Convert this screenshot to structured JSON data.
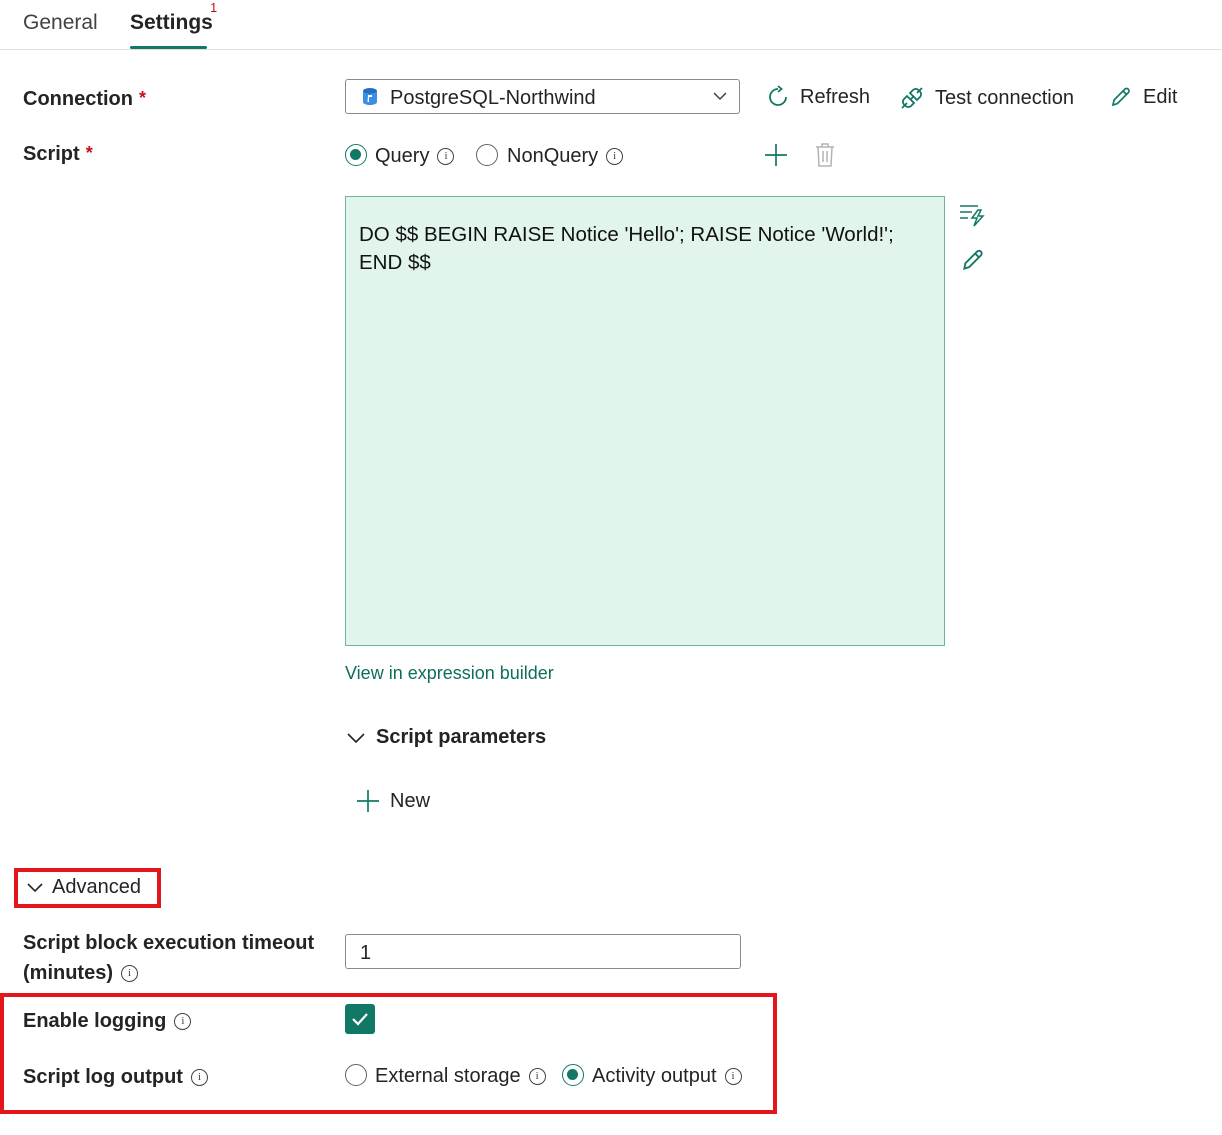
{
  "tabs": [
    {
      "label": "General",
      "active": false
    },
    {
      "label": "Settings",
      "active": true,
      "badge": "1"
    }
  ],
  "connection": {
    "label": "Connection",
    "required_marker": "*",
    "selected": "PostgreSQL-Northwind",
    "icon": "postgresql-database-icon",
    "actions": {
      "refresh": "Refresh",
      "test": "Test connection",
      "edit": "Edit"
    }
  },
  "script": {
    "label": "Script",
    "required_marker": "*",
    "types": [
      {
        "label": "Query",
        "selected": true
      },
      {
        "label": "NonQuery",
        "selected": false
      }
    ],
    "code": "DO $$ BEGIN RAISE Notice 'Hello'; RAISE Notice 'World!'; END $$",
    "expression_link": "View in expression builder",
    "parameters_label": "Script parameters",
    "new_label": "New"
  },
  "advanced": {
    "label": "Advanced",
    "timeout_label_line1": "Script block execution timeout",
    "timeout_label_line2": "(minutes)",
    "timeout_value": "1",
    "logging_label": "Enable logging",
    "logging_enabled": true,
    "log_output_label": "Script log output",
    "log_output_options": [
      {
        "label": "External storage",
        "selected": false
      },
      {
        "label": "Activity output",
        "selected": true
      }
    ]
  },
  "colors": {
    "accent": "#117865",
    "editor_bg": "#e2f5ec",
    "highlight": "#e3161b",
    "required": "#c50f1f"
  }
}
